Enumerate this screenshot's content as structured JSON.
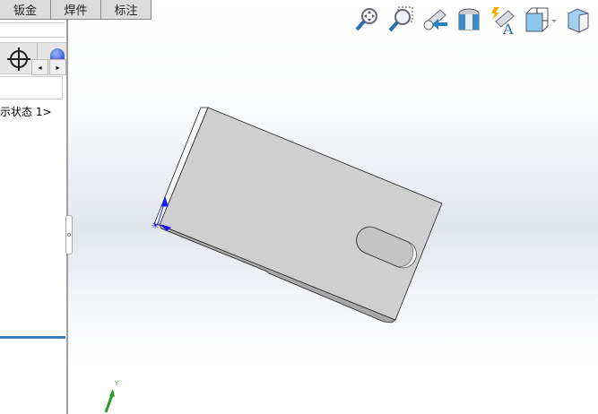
{
  "tabs": [
    "钣金",
    "焊件",
    "标注"
  ],
  "panel": {
    "display_state": "示状态 1>",
    "scroll_left": "◂",
    "scroll_right": "▸"
  },
  "toolbar": [
    "zoom-to-fit-icon",
    "zoom-to-area-icon",
    "previous-view-icon",
    "section-view-icon",
    "dynamic-annotation-view-icon",
    "view-orientation-icon",
    "display-style-icon"
  ],
  "triad": {
    "y_label": "Y"
  },
  "colors": {
    "part_face": "#cfcfcf",
    "accent": "#3c7fc0"
  }
}
